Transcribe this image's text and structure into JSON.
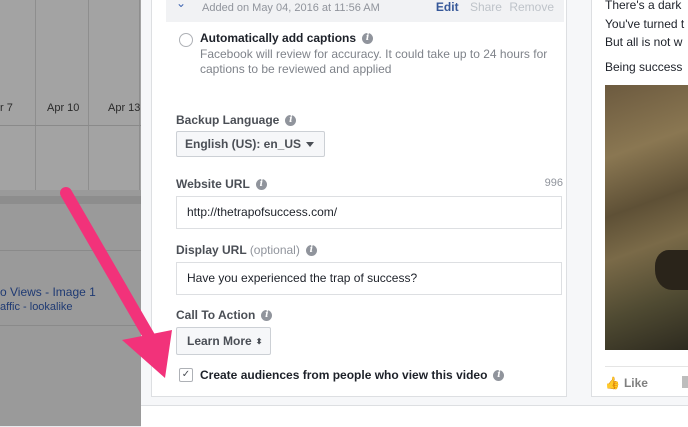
{
  "background": {
    "axis_labels": [
      "r 7",
      "Apr 10",
      "Apr 13"
    ],
    "ad_name": "o Views - Image 1",
    "ad_sub": "affic - lookalike"
  },
  "captions": {
    "added_text": "Added on May 04, 2016 at 11:56 AM",
    "edit": "Edit",
    "share": "Share",
    "remove": "Remove",
    "auto_title": "Automatically add captions",
    "auto_desc": "Facebook will review for accuracy. It could take up to 24 hours for captions to be reviewed and applied"
  },
  "backup_language": {
    "label": "Backup Language",
    "value": "English (US): en_US"
  },
  "website_url": {
    "label": "Website URL",
    "counter": "996",
    "value": "http://thetrapofsuccess.com/"
  },
  "display_url": {
    "label": "Display URL",
    "optional": "(optional)",
    "value": "Have you experienced the trap of success?"
  },
  "call_to_action": {
    "label": "Call To Action",
    "value": "Learn More"
  },
  "audiences": {
    "label": "Create audiences from people who view this video",
    "checked": true
  },
  "preview": {
    "line1": "There's a dark",
    "line2": "You've turned t",
    "line3": "But all is not w",
    "line4": "Being success",
    "like": "Like"
  },
  "colors": {
    "arrow": "#f2327a",
    "link": "#365899",
    "accent": "#4267b2"
  }
}
